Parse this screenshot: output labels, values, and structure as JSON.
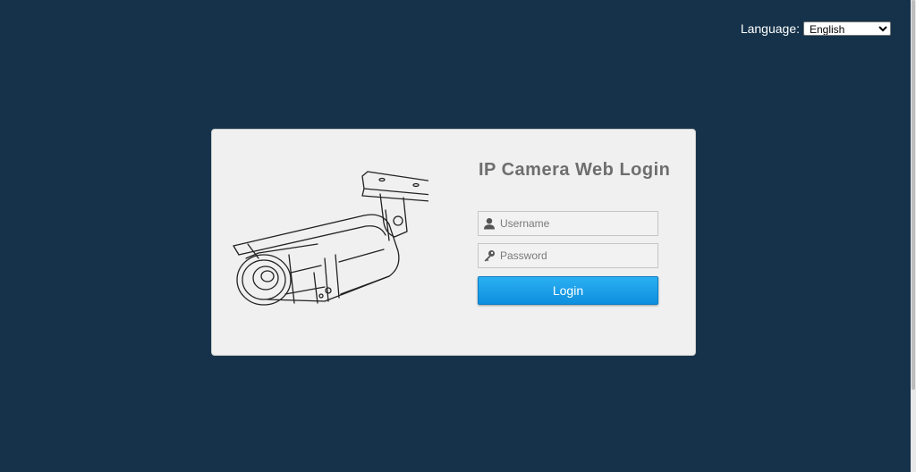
{
  "language": {
    "label": "Language:",
    "selected": "English"
  },
  "login": {
    "title": "IP Camera Web Login",
    "username_placeholder": "Username",
    "password_placeholder": "Password",
    "button_label": "Login"
  },
  "icons": {
    "camera": "camera-illustration",
    "user": "user-icon",
    "key": "key-icon"
  },
  "colors": {
    "background": "#15324a",
    "card": "#f0f0f0",
    "button": "#1a9ee8",
    "title": "#6e6e6e"
  }
}
